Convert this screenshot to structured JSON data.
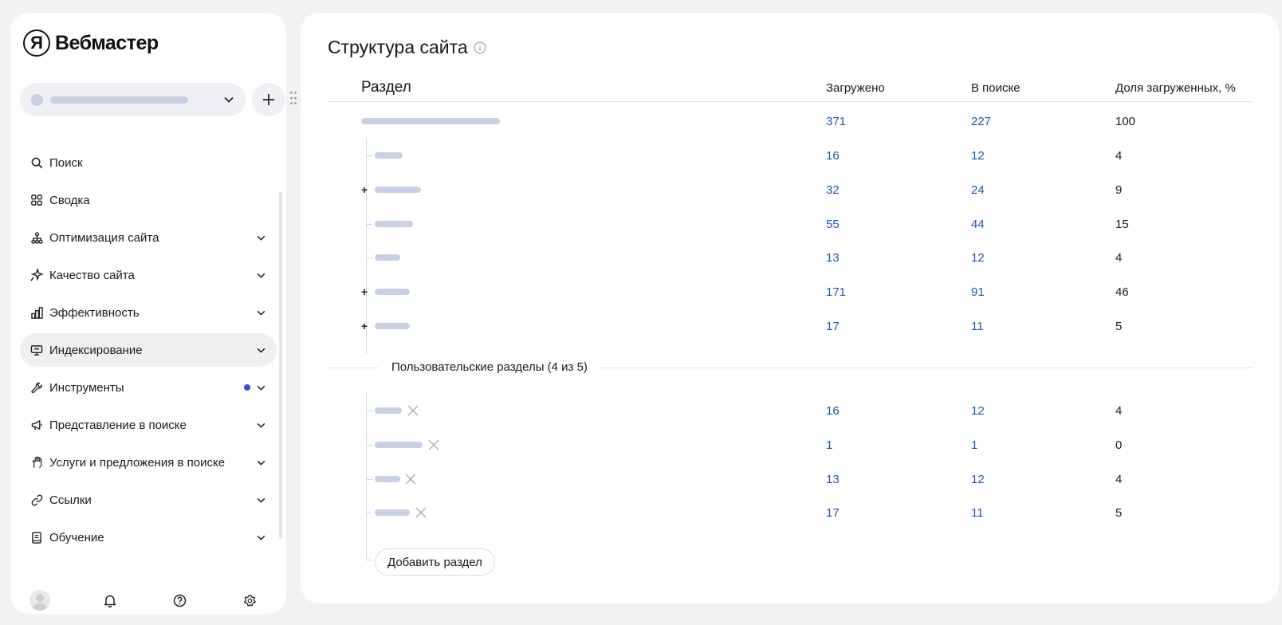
{
  "app": {
    "logo_mark": "Я",
    "logo_text": "Вебмастер"
  },
  "site_selector": {
    "chevron_icon": "chevron-down-icon"
  },
  "nav": [
    {
      "label": "Поиск",
      "icon": "search-icon"
    },
    {
      "label": "Сводка",
      "icon": "grid-icon"
    },
    {
      "label": "Оптимизация сайта",
      "icon": "sitemap-icon"
    },
    {
      "label": "Качество сайта",
      "icon": "sparkle-icon"
    },
    {
      "label": "Эффективность",
      "icon": "bar-chart-icon"
    },
    {
      "label": "Индексирование",
      "icon": "monitor-icon",
      "active": true
    },
    {
      "label": "Инструменты",
      "icon": "wrench-icon",
      "badge": true
    },
    {
      "label": "Представление в поиске",
      "icon": "megaphone-icon"
    },
    {
      "label": "Услуги и предложения в поиске",
      "icon": "hand-icon"
    },
    {
      "label": "Ссылки",
      "icon": "link-icon"
    },
    {
      "label": "Обучение",
      "icon": "book-icon"
    }
  ],
  "footer": {
    "icons": [
      "avatar",
      "bell-icon",
      "help-icon",
      "gear-icon"
    ]
  },
  "main": {
    "title": "Структура сайта",
    "table": {
      "headers": {
        "section": "Раздел",
        "loaded": "Загружено",
        "in_search": "В поиске",
        "share": "Доля загруженных, %"
      },
      "root": {
        "loaded": "371",
        "in_search": "227",
        "share": "100"
      },
      "rows": [
        {
          "loaded": "16",
          "in_search": "12",
          "share": "4",
          "expandable": false
        },
        {
          "loaded": "32",
          "in_search": "24",
          "share": "9",
          "expandable": true,
          "expand_label": "+"
        },
        {
          "loaded": "55",
          "in_search": "44",
          "share": "15",
          "expandable": false
        },
        {
          "loaded": "13",
          "in_search": "12",
          "share": "4",
          "expandable": false
        },
        {
          "loaded": "171",
          "in_search": "91",
          "share": "46",
          "expandable": true,
          "expand_label": "+"
        },
        {
          "loaded": "17",
          "in_search": "11",
          "share": "5",
          "expandable": true,
          "expand_label": "+"
        }
      ]
    },
    "custom_sections": {
      "title": "Пользовательские разделы (4 из 5)",
      "rows": [
        {
          "loaded": "16",
          "in_search": "12",
          "share": "4"
        },
        {
          "loaded": "1",
          "in_search": "1",
          "share": "0"
        },
        {
          "loaded": "13",
          "in_search": "12",
          "share": "4"
        },
        {
          "loaded": "17",
          "in_search": "11",
          "share": "5"
        }
      ],
      "add_button": "Добавить раздел"
    }
  },
  "colors": {
    "link": "#1d55a8",
    "placeholder": "#c8d0e4",
    "badge": "#2f4fe6",
    "active_nav": "#efefef"
  }
}
